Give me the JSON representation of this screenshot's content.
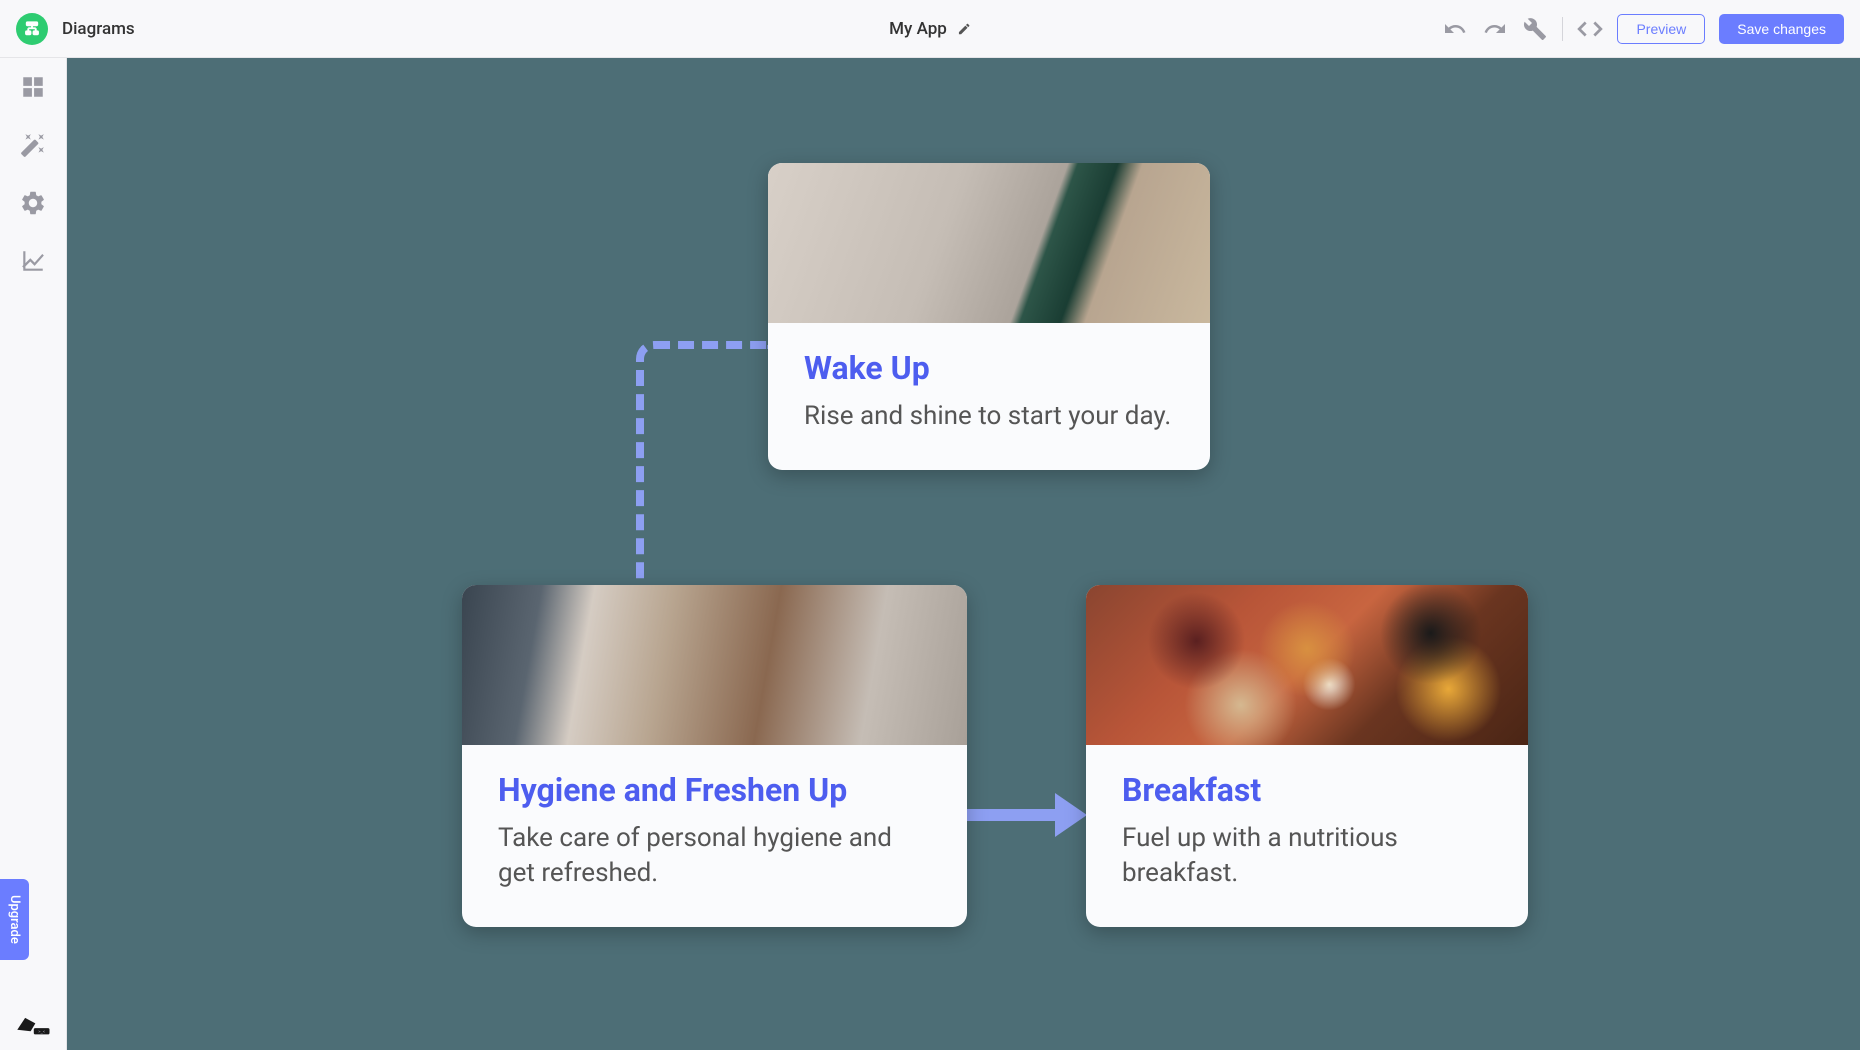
{
  "header": {
    "section_title": "Diagrams",
    "app_title": "My App"
  },
  "actions": {
    "preview": "Preview",
    "save": "Save changes"
  },
  "sidebar": {
    "upgrade": "Upgrade"
  },
  "chart_data": {
    "type": "flowchart",
    "nodes": [
      {
        "id": "wake_up",
        "title": "Wake Up",
        "description": "Rise and shine to start your day."
      },
      {
        "id": "hygiene",
        "title": "Hygiene and Freshen Up",
        "description": "Take care of personal hygiene and get refreshed."
      },
      {
        "id": "breakfast",
        "title": "Breakfast",
        "description": "Fuel up with a nutritious breakfast."
      }
    ],
    "edges": [
      {
        "from": "wake_up",
        "to": "hygiene",
        "style": "dashed"
      },
      {
        "from": "hygiene",
        "to": "breakfast",
        "style": "solid-arrow"
      }
    ]
  },
  "colors": {
    "accent": "#6b7dff",
    "canvas_bg": "#4d6e76",
    "card_title": "#4d5def",
    "connector": "#8d9ff2"
  }
}
